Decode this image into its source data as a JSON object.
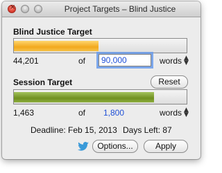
{
  "window": {
    "title": "Project Targets – Blind Justice"
  },
  "project": {
    "label": "Blind Justice Target",
    "current_words": "44,201",
    "of_text": "of",
    "target_words": "90,000",
    "unit": "words",
    "progress_fraction": 0.4911,
    "bar_color": "#f2a91e"
  },
  "session": {
    "label": "Session Target",
    "reset_label": "Reset",
    "current_words": "1,463",
    "of_text": "of",
    "target_words": "1,800",
    "unit": "words",
    "progress_fraction": 0.8128,
    "bar_color": "#6f8f1f"
  },
  "footer": {
    "deadline_text": "Deadline: Feb 15, 2013",
    "days_left_text": "Days Left: 87"
  },
  "buttons": {
    "options_label": "Options...",
    "apply_label": "Apply"
  },
  "icons": {
    "stepper": "stepper-icon",
    "twitter": "twitter-bird-icon"
  },
  "colors": {
    "link_blue": "#1f4fd6",
    "focus_ring": "#699beb",
    "twitter_blue": "#3a9ad9"
  }
}
